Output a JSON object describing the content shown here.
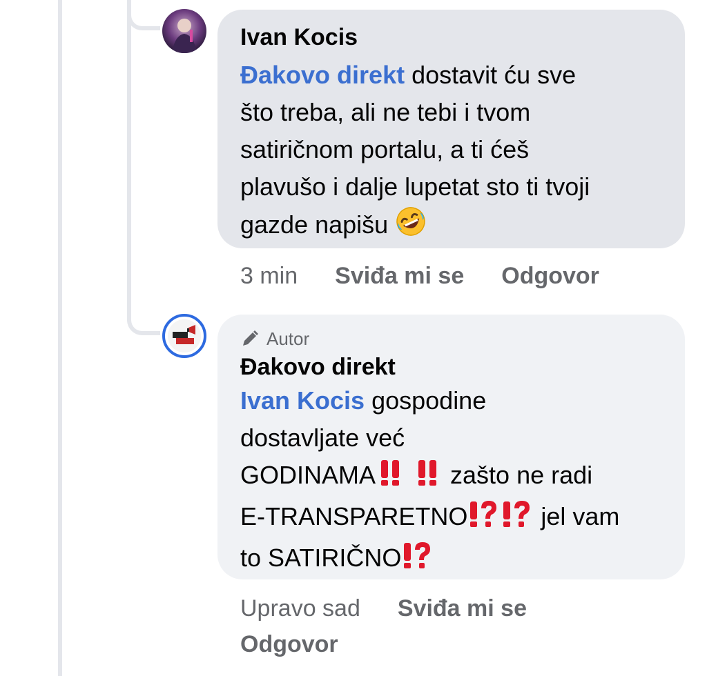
{
  "comment1": {
    "author": "Ivan Kocis",
    "mention": "Đakovo direkt",
    "lines": [
      " dostavit ću sve",
      "što treba, ali ne tebi i tvom",
      "satiričnom portalu, a ti ćeš",
      "plavušo i dalje lupetat sto ti tvoji",
      "gazde napišu"
    ],
    "emoji": "rolling-on-floor-laughing",
    "time": "3 min",
    "like_label": "Sviđa mi se",
    "reply_label": "Odgovor"
  },
  "comment2": {
    "badge": "Autor",
    "author": "Đakovo direkt",
    "mention": "Ivan Kocis",
    "line1": " gospodine",
    "line2": "dostavljate već",
    "line3a": "GODINAMA",
    "line3b": " zašto ne radi",
    "line4a": "E-TRANSPARETNO",
    "line4b": " jel vam",
    "line5a": "to SATIRIČNO",
    "emojis": [
      "double-exclamation",
      "double-exclamation",
      "exclamation-question",
      "exclamation-question",
      "exclamation-question"
    ],
    "time": "Upravo sad",
    "like_label": "Sviđa mi se",
    "reply_label": "Odgovor"
  },
  "colors": {
    "mention": "#3b6fd0",
    "bubble_gray": "#e4e6eb",
    "bubble_light": "#f0f2f5",
    "meta_text": "#65676b",
    "avatar_ring": "#2d6ae0",
    "emoji_red": "#e0182b"
  }
}
